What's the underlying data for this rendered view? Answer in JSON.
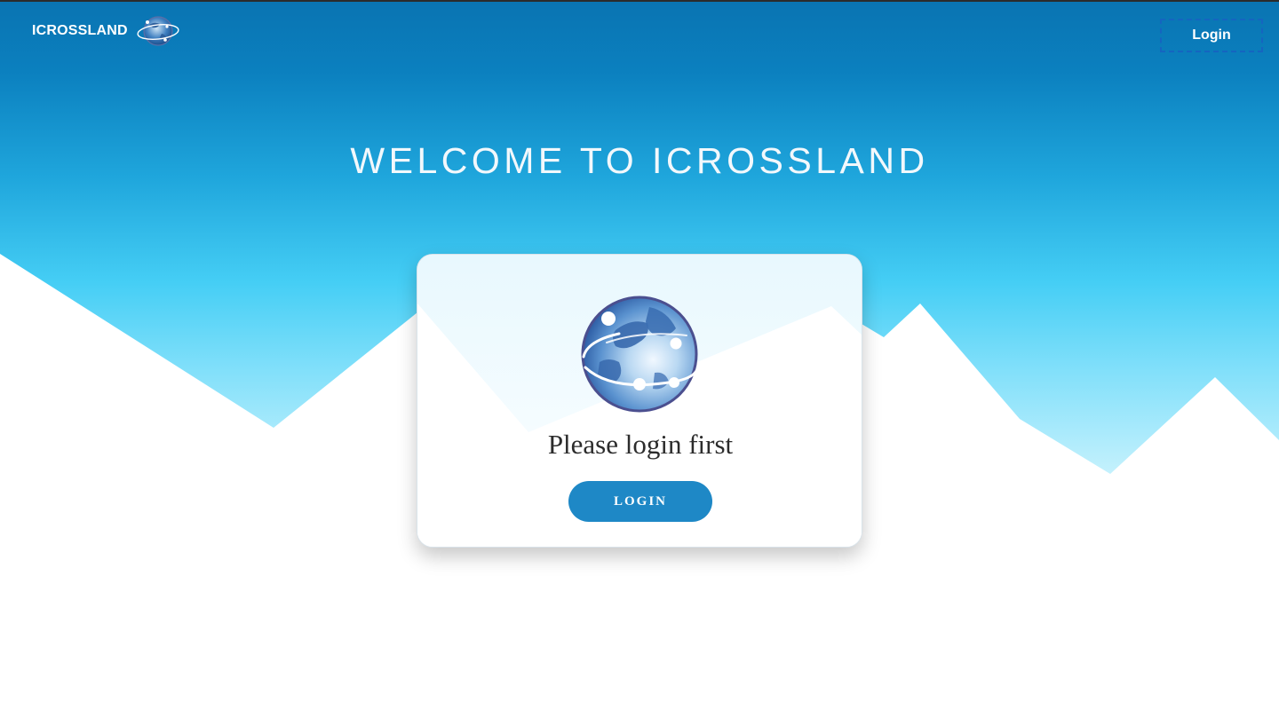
{
  "navbar": {
    "brand_name": "ICROSSLAND",
    "brand_logo_icon": "globe-logo-icon",
    "login_label": "Login"
  },
  "hero": {
    "welcome_title": "WELCOME TO ICROSSLAND"
  },
  "login_card": {
    "icon": "globe-icon",
    "message": "Please login first",
    "login_button_label": "LOGIN"
  },
  "colors": {
    "sky_top": "#0a78b8",
    "sky_mid": "#36c3ee",
    "sky_bottom": "#a9ecfb",
    "button_blue": "#1e88c6",
    "mountain_white": "#ffffff"
  }
}
